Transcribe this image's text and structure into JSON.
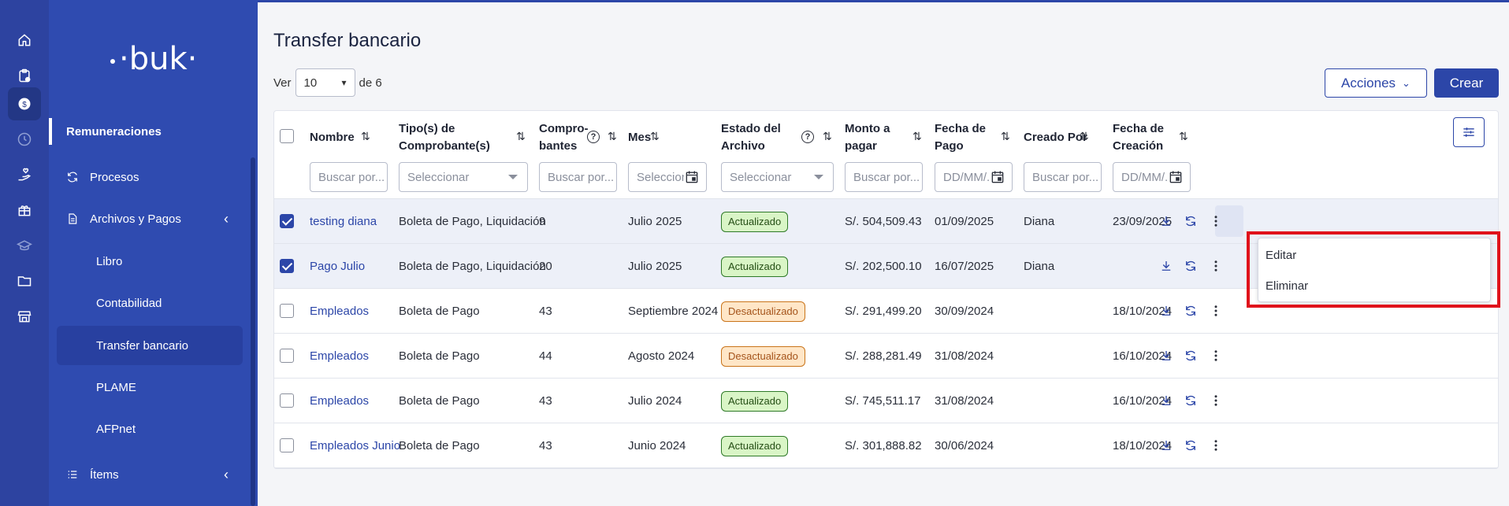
{
  "sidebar": {
    "logo": "·buk·",
    "section": "Remuneraciones",
    "items": [
      {
        "label": "Procesos",
        "icon": "refresh-icon"
      },
      {
        "label": "Archivos y Pagos",
        "icon": "document-icon",
        "expanded": true
      }
    ],
    "sub_items": [
      "Libro",
      "Contabilidad",
      "Transfer bancario",
      "PLAME",
      "AFPnet"
    ],
    "active_sub": "Transfer bancario",
    "bottom_item": {
      "label": "Ítems",
      "icon": "list-icon"
    }
  },
  "rail_icons": [
    "home-icon",
    "clipboard-icon",
    "money-icon",
    "clock-icon",
    "hand-heart-icon",
    "gift-icon",
    "graduation-icon",
    "folder-icon",
    "store-icon"
  ],
  "main": {
    "title": "Transfer bancario",
    "ver_label": "Ver",
    "page_size": "10",
    "of_label": "de 6",
    "acciones_label": "Acciones",
    "crear_label": "Crear"
  },
  "table": {
    "headers": {
      "nombre": "Nombre",
      "tipo_1": "Tipo(s) de",
      "tipo_2": "Comprobante(s)",
      "comp_1": "Compro-",
      "comp_2": "bantes",
      "mes": "Mes",
      "estado_1": "Estado del",
      "estado_2": "Archivo",
      "monto_1": "Monto a",
      "monto_2": "pagar",
      "fecha_pago_1": "Fecha de",
      "fecha_pago_2": "Pago",
      "creado": "Creado Por",
      "fecha_cre_1": "Fecha de",
      "fecha_cre_2": "Creación"
    },
    "filters": {
      "nombre": "Buscar por...",
      "tipo": "Seleccionar",
      "comp": "Buscar por...",
      "mes": "Seleccionar",
      "estado": "Seleccionar",
      "monto": "Buscar por...",
      "fecha_pago": "DD/MM/...",
      "creado": "Buscar por...",
      "fecha_cre": "DD/MM/..."
    },
    "rows": [
      {
        "checked": true,
        "nombre": "testing diana",
        "tipo": "Boleta de Pago, Liquidación",
        "comp": "9",
        "mes": "Julio 2025",
        "estado": "Actualizado",
        "monto": "S/. 504,509.43",
        "fecha_pago": "01/09/2025",
        "creado": "Diana",
        "fecha_cre": "23/09/2025"
      },
      {
        "checked": true,
        "nombre": "Pago Julio",
        "tipo": "Boleta de Pago, Liquidación",
        "comp": "20",
        "mes": "Julio 2025",
        "estado": "Actualizado",
        "monto": "S/. 202,500.10",
        "fecha_pago": "16/07/2025",
        "creado": "Diana",
        "fecha_cre": ""
      },
      {
        "checked": false,
        "nombre": "Empleados",
        "tipo": "Boleta de Pago",
        "comp": "43",
        "mes": "Septiembre 2024",
        "estado": "Desactualizado",
        "monto": "S/. 291,499.20",
        "fecha_pago": "30/09/2024",
        "creado": "",
        "fecha_cre": "18/10/2024"
      },
      {
        "checked": false,
        "nombre": "Empleados",
        "tipo": "Boleta de Pago",
        "comp": "44",
        "mes": "Agosto 2024",
        "estado": "Desactualizado",
        "monto": "S/. 288,281.49",
        "fecha_pago": "31/08/2024",
        "creado": "",
        "fecha_cre": "16/10/2024"
      },
      {
        "checked": false,
        "nombre": "Empleados",
        "tipo": "Boleta de Pago",
        "comp": "43",
        "mes": "Julio 2024",
        "estado": "Actualizado",
        "monto": "S/. 745,511.17",
        "fecha_pago": "31/08/2024",
        "creado": "",
        "fecha_cre": "16/10/2024"
      },
      {
        "checked": false,
        "nombre": "Empleados Junio",
        "tipo": "Boleta de Pago",
        "comp": "43",
        "mes": "Junio 2024",
        "estado": "Actualizado",
        "monto": "S/. 301,888.82",
        "fecha_pago": "30/06/2024",
        "creado": "",
        "fecha_cre": "18/10/2024"
      }
    ]
  },
  "row_menu": {
    "items": [
      "Editar",
      "Eliminar"
    ]
  },
  "colors": {
    "brand": "#2c46a8",
    "sidebar": "#2f4bb0",
    "rail": "#2d43a0",
    "ok_bg": "#d9f5c6",
    "warn_bg": "#ffe6c7",
    "highlight": "#e0121b"
  }
}
